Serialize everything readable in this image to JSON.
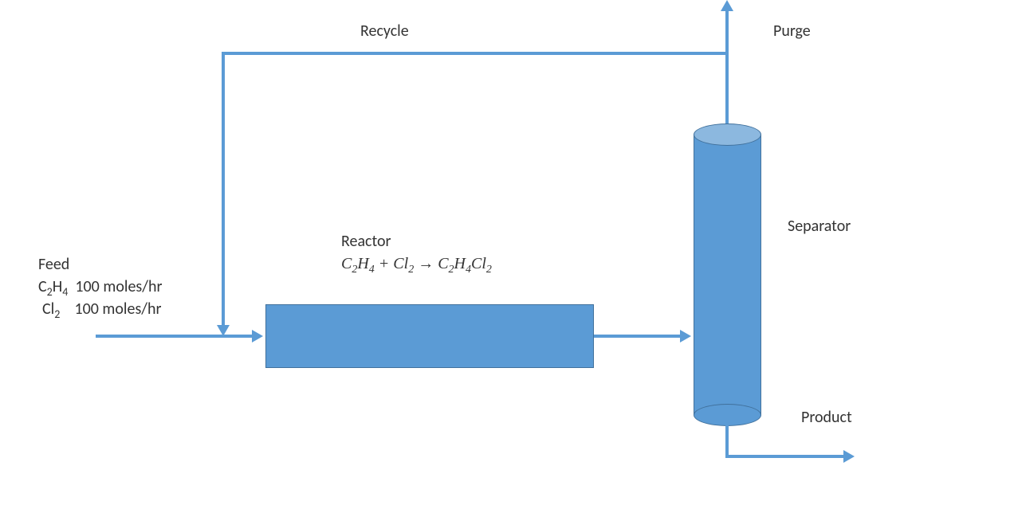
{
  "labels": {
    "recycle": "Recycle",
    "purge": "Purge",
    "separator": "Separator",
    "product": "Product",
    "reactor_title": "Reactor",
    "feed_title": "Feed"
  },
  "feed": {
    "species1": "C₂H₄",
    "rate1": "100 moles/hr",
    "species2": "Cl₂",
    "rate2": "100 moles/hr"
  },
  "reaction": {
    "reactant1": "C₂H₄",
    "plus": " + ",
    "reactant2": "Cl₂",
    "arrow": " → ",
    "product": "C₂H₄Cl₂"
  },
  "colors": {
    "shape_fill": "#5b9bd5",
    "shape_border": "#41719c"
  }
}
